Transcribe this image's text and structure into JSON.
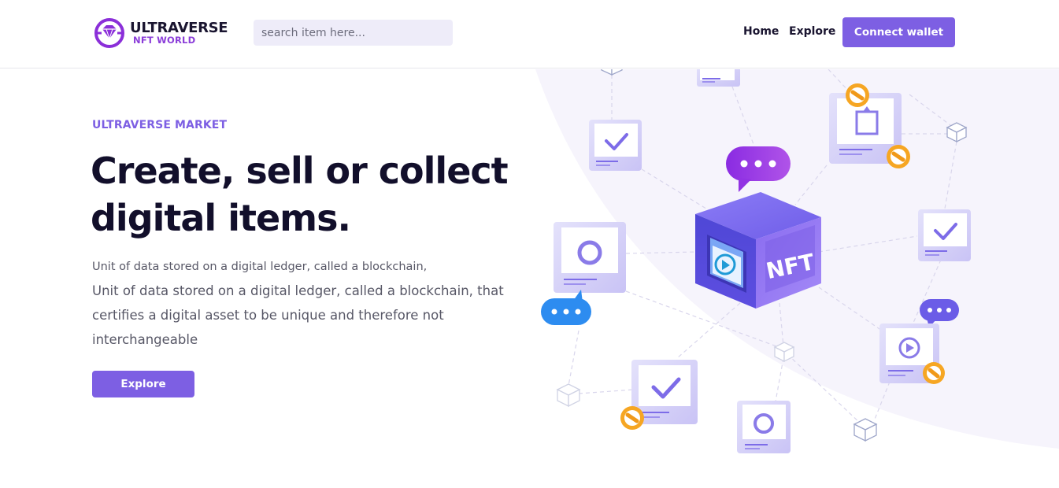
{
  "brand": {
    "name_line1": "ULTRAVERSE",
    "name_line2": "NFT WORLD"
  },
  "header": {
    "search_placeholder": "search item here...",
    "nav": [
      {
        "label": "Home"
      },
      {
        "label": "Explore"
      }
    ],
    "connect_label": "Connect wallet"
  },
  "hero": {
    "eyebrow": "ULTRAVERSE MARKET",
    "headline": "Create, sell or collect digital items.",
    "subtitle_short": "Unit of data stored on a digital ledger, called a blockchain,",
    "subtitle_long": "Unit of data stored on a digital ledger, called a blockchain, that certifies a digital asset to be unique and therefore not interchangeable",
    "explore_label": "Explore"
  },
  "illustration": {
    "cube_label": "NFT"
  },
  "colors": {
    "accent": "#7d5fe3",
    "headline": "#120f2b",
    "body_text": "#575766",
    "search_bg": "#eeecf9",
    "hero_curve": "#f6f4fc",
    "coin": "#f6a623"
  }
}
